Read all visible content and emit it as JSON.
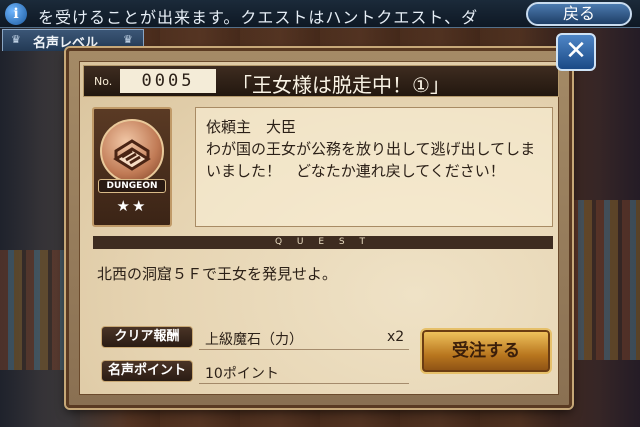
{
  "ticker": {
    "text": "を受けることが出来ます。クエストはハントクエスト、ダ",
    "back_label": "戻る"
  },
  "fame_tab": {
    "label": "名声レベル"
  },
  "quest": {
    "no_label": "No.",
    "number": "0005",
    "title": "「王女様は脱走中！①」",
    "client": "依頼主　大臣",
    "message": "わが国の王女が公務を放り出して逃げ出してしまいました！　どなたか連れ戻してください！",
    "type_label": "DUNGEON",
    "stars": "★★",
    "band_label": "Q U E S T",
    "objective": "北西の洞窟５Ｆで王女を発見せよ。",
    "reward_label": "クリア報酬",
    "reward_item": "上級魔石（力）",
    "reward_qty": "x2",
    "fame_label": "名声ポイント",
    "fame_points": "10ポイント",
    "order_label": "受注する"
  },
  "colors": {
    "panel": "#e6d4b2",
    "title_bar": "#2a1d14",
    "accent_blue": "#2c5f9e",
    "gold": "#d89a34"
  }
}
